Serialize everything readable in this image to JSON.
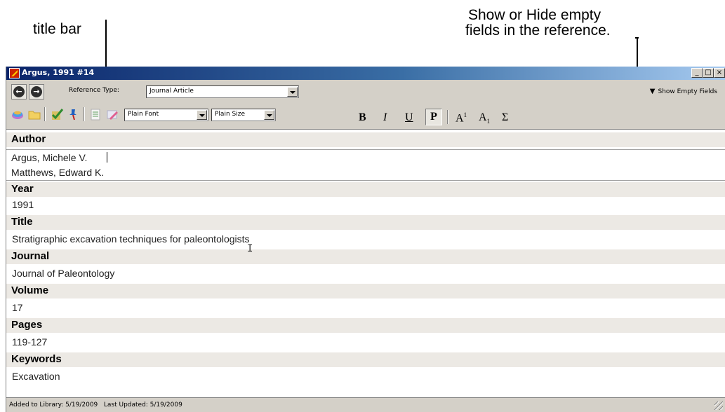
{
  "annotations": {
    "title_bar": "title bar",
    "show_hide_line1": "Show or Hide empty",
    "show_hide_line2": "fields in the reference."
  },
  "window": {
    "title": "Argus, 1991 #14",
    "controls": {
      "minimize": "_",
      "maximize": "□",
      "close": "×"
    }
  },
  "toolbar_row1": {
    "back_icon": "arrow-left-icon",
    "forward_icon": "arrow-right-icon",
    "reference_type_label": "Reference Type:",
    "reference_type_value": "Journal Article",
    "show_empty_fields": "Show Empty Fields"
  },
  "toolbar_row2": {
    "font_value": "Plain Font",
    "size_value": "Plain Size",
    "bold": "B",
    "italic": "I",
    "underline": "U",
    "plain": "P",
    "superscript_base": "A",
    "superscript_mark": "1",
    "subscript_base": "A",
    "subscript_mark": "1",
    "symbol": "Σ"
  },
  "fields": {
    "author": {
      "label": "Author",
      "values": [
        "Argus, Michele V.",
        "Matthews, Edward K."
      ]
    },
    "year": {
      "label": "Year",
      "value": "1991"
    },
    "title": {
      "label": "Title",
      "value": "Stratigraphic excavation techniques for paleontologists"
    },
    "journal": {
      "label": "Journal",
      "value": "Journal of Paleontology"
    },
    "volume": {
      "label": "Volume",
      "value": "17"
    },
    "pages": {
      "label": "Pages",
      "value": "119-127"
    },
    "keywords": {
      "label": "Keywords",
      "value": "Excavation"
    }
  },
  "status": {
    "text": "Added to Library: 5/19/2009   Last Updated: 5/19/2009"
  }
}
